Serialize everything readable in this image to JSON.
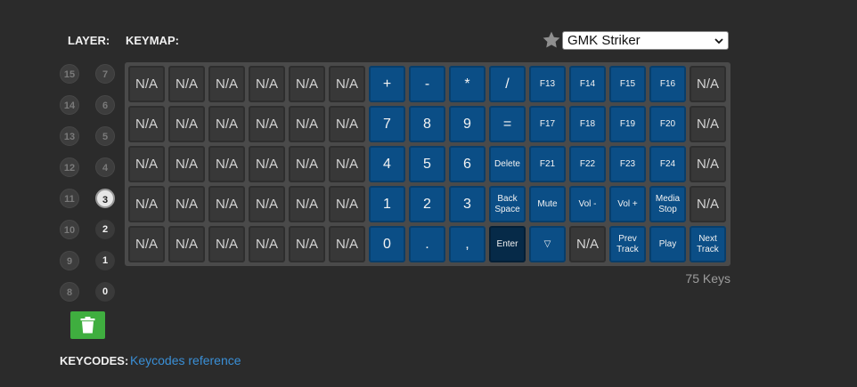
{
  "header": {
    "layer_label": "LAYER:",
    "keymap_label": "KEYMAP:",
    "theme_select": {
      "value": "GMK Striker"
    }
  },
  "layers": [
    {
      "label": "15",
      "state": "empty"
    },
    {
      "label": "7",
      "state": "empty"
    },
    {
      "label": "14",
      "state": "empty"
    },
    {
      "label": "6",
      "state": "empty"
    },
    {
      "label": "13",
      "state": "empty"
    },
    {
      "label": "5",
      "state": "empty"
    },
    {
      "label": "12",
      "state": "empty"
    },
    {
      "label": "4",
      "state": "empty"
    },
    {
      "label": "11",
      "state": "empty"
    },
    {
      "label": "3",
      "state": "selected"
    },
    {
      "label": "10",
      "state": "empty"
    },
    {
      "label": "2",
      "state": "used"
    },
    {
      "label": "9",
      "state": "empty"
    },
    {
      "label": "1",
      "state": "used"
    },
    {
      "label": "8",
      "state": "empty"
    },
    {
      "label": "0",
      "state": "used"
    }
  ],
  "keymap": {
    "rows": [
      [
        {
          "l": "N/A",
          "s": "na"
        },
        {
          "l": "N/A",
          "s": "na"
        },
        {
          "l": "N/A",
          "s": "na"
        },
        {
          "l": "N/A",
          "s": "na"
        },
        {
          "l": "N/A",
          "s": "na"
        },
        {
          "l": "N/A",
          "s": "na"
        },
        {
          "l": "+",
          "s": "bl"
        },
        {
          "l": "-",
          "s": "bl"
        },
        {
          "l": "*",
          "s": "bl"
        },
        {
          "l": "/",
          "s": "bl"
        },
        {
          "l": "F13",
          "s": "bl"
        },
        {
          "l": "F14",
          "s": "bl"
        },
        {
          "l": "F15",
          "s": "bl"
        },
        {
          "l": "F16",
          "s": "bl"
        },
        {
          "l": "N/A",
          "s": "na"
        }
      ],
      [
        {
          "l": "N/A",
          "s": "na"
        },
        {
          "l": "N/A",
          "s": "na"
        },
        {
          "l": "N/A",
          "s": "na"
        },
        {
          "l": "N/A",
          "s": "na"
        },
        {
          "l": "N/A",
          "s": "na"
        },
        {
          "l": "N/A",
          "s": "na"
        },
        {
          "l": "7",
          "s": "bl"
        },
        {
          "l": "8",
          "s": "bl"
        },
        {
          "l": "9",
          "s": "bl"
        },
        {
          "l": "=",
          "s": "bl"
        },
        {
          "l": "F17",
          "s": "bl"
        },
        {
          "l": "F18",
          "s": "bl"
        },
        {
          "l": "F19",
          "s": "bl"
        },
        {
          "l": "F20",
          "s": "bl"
        },
        {
          "l": "N/A",
          "s": "na"
        }
      ],
      [
        {
          "l": "N/A",
          "s": "na"
        },
        {
          "l": "N/A",
          "s": "na"
        },
        {
          "l": "N/A",
          "s": "na"
        },
        {
          "l": "N/A",
          "s": "na"
        },
        {
          "l": "N/A",
          "s": "na"
        },
        {
          "l": "N/A",
          "s": "na"
        },
        {
          "l": "4",
          "s": "bl"
        },
        {
          "l": "5",
          "s": "bl"
        },
        {
          "l": "6",
          "s": "bl"
        },
        {
          "l": "Delete",
          "s": "bl"
        },
        {
          "l": "F21",
          "s": "bl"
        },
        {
          "l": "F22",
          "s": "bl"
        },
        {
          "l": "F23",
          "s": "bl"
        },
        {
          "l": "F24",
          "s": "bl"
        },
        {
          "l": "N/A",
          "s": "na"
        }
      ],
      [
        {
          "l": "N/A",
          "s": "na"
        },
        {
          "l": "N/A",
          "s": "na"
        },
        {
          "l": "N/A",
          "s": "na"
        },
        {
          "l": "N/A",
          "s": "na"
        },
        {
          "l": "N/A",
          "s": "na"
        },
        {
          "l": "N/A",
          "s": "na"
        },
        {
          "l": "1",
          "s": "bl"
        },
        {
          "l": "2",
          "s": "bl"
        },
        {
          "l": "3",
          "s": "bl"
        },
        {
          "l": "Back\nSpace",
          "s": "bl"
        },
        {
          "l": "Mute",
          "s": "bl"
        },
        {
          "l": "Vol -",
          "s": "bl"
        },
        {
          "l": "Vol +",
          "s": "bl"
        },
        {
          "l": "Media\nStop",
          "s": "bl"
        },
        {
          "l": "N/A",
          "s": "na"
        }
      ],
      [
        {
          "l": "N/A",
          "s": "na"
        },
        {
          "l": "N/A",
          "s": "na"
        },
        {
          "l": "N/A",
          "s": "na"
        },
        {
          "l": "N/A",
          "s": "na"
        },
        {
          "l": "N/A",
          "s": "na"
        },
        {
          "l": "N/A",
          "s": "na"
        },
        {
          "l": "0",
          "s": "bl"
        },
        {
          "l": ".",
          "s": "bl"
        },
        {
          "l": ",",
          "s": "bl"
        },
        {
          "l": "Enter",
          "s": "dk"
        },
        {
          "l": "▽",
          "s": "bl"
        },
        {
          "l": "N/A",
          "s": "na"
        },
        {
          "l": "Prev\nTrack",
          "s": "bl"
        },
        {
          "l": "Play",
          "s": "bl"
        },
        {
          "l": "Next\nTrack",
          "s": "bl"
        }
      ]
    ],
    "key_count": "75 Keys"
  },
  "footer": {
    "keycodes_label": "KEYCODES:",
    "keycodes_link": "Keycodes reference"
  },
  "colors": {
    "background": "#2b2b2b",
    "key_blue": "#0b4e86",
    "key_selected": "#062a48",
    "key_empty": "#383838",
    "trash_green": "#3fae3f",
    "link": "#3a8fd6"
  }
}
